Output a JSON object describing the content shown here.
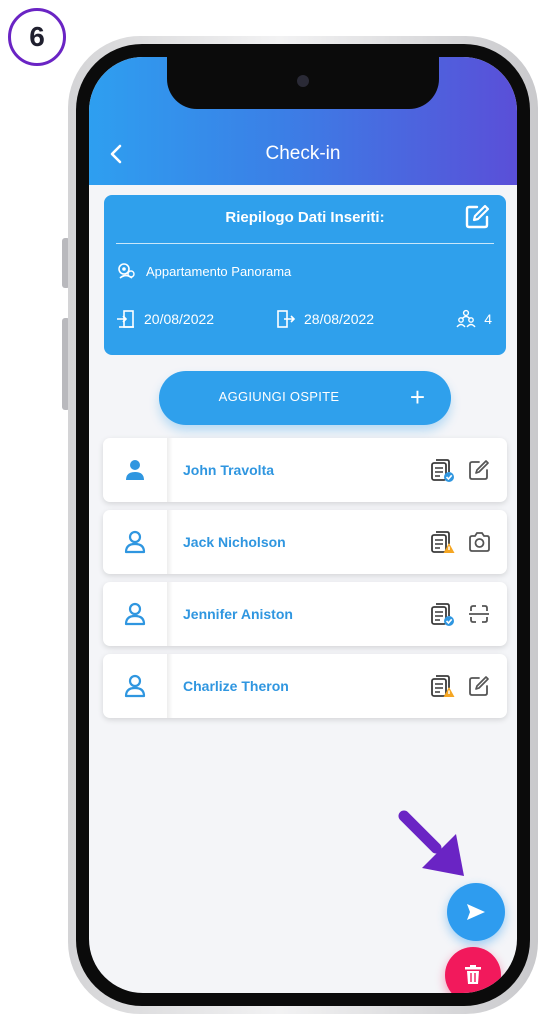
{
  "step": {
    "number": "6"
  },
  "header": {
    "title": "Check-in",
    "back_icon": "chevron-left-icon"
  },
  "summary": {
    "title": "Riepilogo Dati Inseriti:",
    "edit_icon": "edit-icon",
    "property": "Appartamento Panorama",
    "checkin_date": "20/08/2022",
    "checkout_date": "28/08/2022",
    "guests_count": "4"
  },
  "add_guest": {
    "label": "AGGIUNGI OSPITE",
    "icon": "plus-icon"
  },
  "guests": [
    {
      "name": "John Travolta",
      "avatar": "user-filled-icon",
      "doc_status": "document-ok-icon",
      "action": "edit-icon"
    },
    {
      "name": "Jack Nicholson",
      "avatar": "user-outline-icon",
      "doc_status": "document-warning-icon",
      "action": "camera-icon"
    },
    {
      "name": "Jennifer Aniston",
      "avatar": "user-outline-icon",
      "doc_status": "document-ok-icon",
      "action": "scan-icon"
    },
    {
      "name": "Charlize Theron",
      "avatar": "user-outline-icon",
      "doc_status": "document-warning-icon",
      "action": "edit-icon"
    }
  ],
  "colors": {
    "primary": "#2fa0ec",
    "header_gradient_end": "#5a4fd8",
    "danger": "#f2195c",
    "warning": "#f5a623",
    "step_badge": "#6a24c4",
    "pointer_arrow": "#6a24c4"
  },
  "fabs": {
    "send_icon": "send-icon",
    "delete_icon": "trash-icon"
  }
}
